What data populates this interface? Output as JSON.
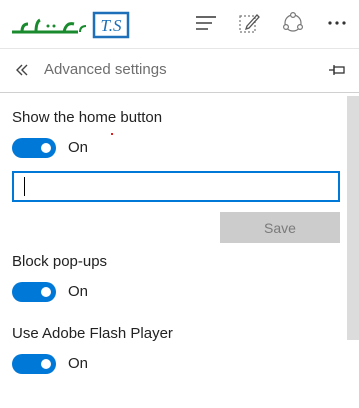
{
  "toolbar": {
    "logo_text": "T.S",
    "logo_script": "تهران",
    "logo_accent": "#1a8a2e",
    "icons": [
      "hub-icon",
      "web-note-icon",
      "share-icon",
      "more-icon"
    ]
  },
  "panel": {
    "title": "Advanced settings",
    "back_icon": "double-chevron-left-icon",
    "pin_icon": "pin-icon"
  },
  "settings": {
    "home_button": {
      "label": "Show the home button",
      "toggle_text": "On",
      "enabled": true,
      "url_value": "",
      "save_label": "Save"
    },
    "popups": {
      "label": "Block pop-ups",
      "toggle_text": "On",
      "enabled": true
    },
    "flash": {
      "label": "Use Adobe Flash Player",
      "toggle_text": "On",
      "enabled": true
    }
  },
  "colors": {
    "accent": "#0078d7",
    "disabled_button": "#cccccc",
    "title_gray": "#6e6e6e"
  }
}
